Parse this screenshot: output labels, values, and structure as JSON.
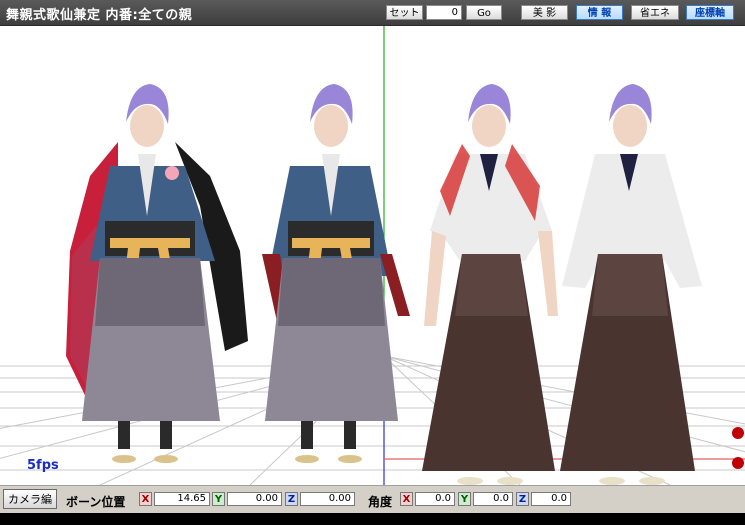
{
  "window": {
    "title": "舞親式歌仙兼定 内番:全ての親"
  },
  "toolbar": {
    "set_label": "セット",
    "frame_value": "0",
    "go_label": "Go",
    "beauty_shadow_label": "美 影",
    "info_label": "情 報",
    "power_save_label": "省エネ",
    "axis_label": "座標軸"
  },
  "viewport": {
    "fps": "5fps",
    "background": "#ffffff",
    "grid_color": "#c8c8c8",
    "axis_green": "#22b022",
    "axis_red": "#e03030",
    "axis_blue": "#3030e0",
    "models": [
      {
        "name": "kasen-formal-with-cape",
        "hair": "#9a86d8",
        "robe": "#3f5f86",
        "hakama": "#8e8796",
        "cape": "#c8203a"
      },
      {
        "name": "kasen-formal",
        "hair": "#9a86d8",
        "robe": "#3f5f86",
        "hakama": "#8e8796"
      },
      {
        "name": "kasen-uchiban-tasuki",
        "hair": "#9a86d8",
        "robe": "#ececec",
        "hakama": "#4a3430"
      },
      {
        "name": "kasen-uchiban",
        "hair": "#9a86d8",
        "robe": "#ececec",
        "hakama": "#4a3430"
      }
    ]
  },
  "bottom_panel": {
    "camera_button": "カメラ編",
    "bone_position_label": "ボーン位置",
    "pos_x": "14.65",
    "pos_y": "0.00",
    "pos_z": "0.00",
    "angle_label": "角度",
    "rot_x": "0.0",
    "rot_y": "0.0",
    "rot_z": "0.0",
    "x_axis": "X",
    "y_axis": "Y",
    "z_axis": "Z"
  }
}
